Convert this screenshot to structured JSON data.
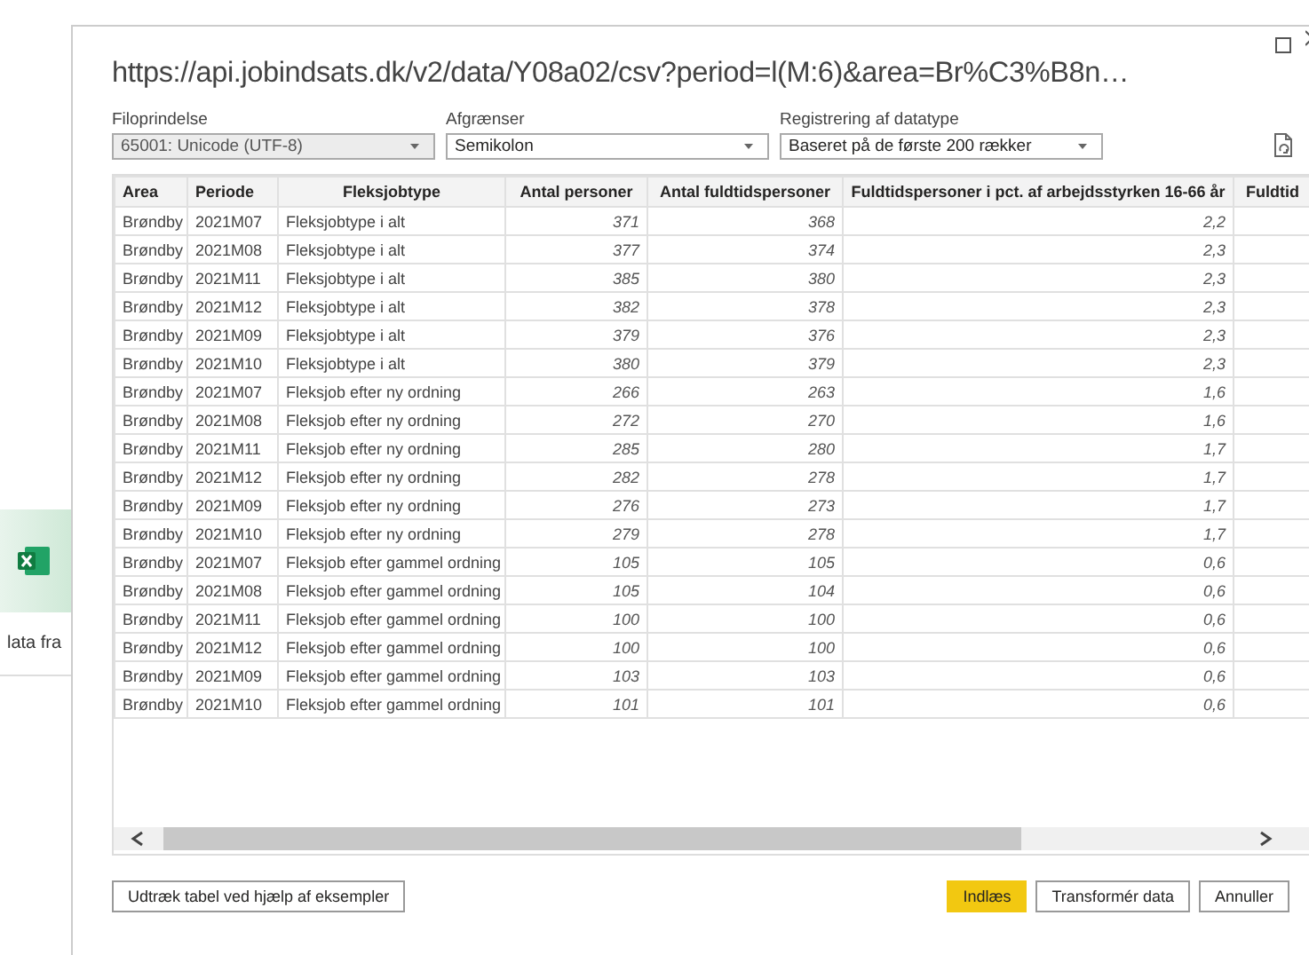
{
  "background_window": {
    "text": "lata fra"
  },
  "dialog": {
    "title": "https://api.jobindsats.dk/v2/data/Y08a02/csv?period=l(M:6)&area=Br%C3%B8n…"
  },
  "options": [
    {
      "label": "Filoprindelse",
      "value": "65001: Unicode (UTF-8)",
      "disabled": true
    },
    {
      "label": "Afgrænser",
      "value": "Semikolon",
      "disabled": false
    },
    {
      "label": "Registrering af datatype",
      "value": "Baseret på de første 200 rækker",
      "disabled": false
    }
  ],
  "table": {
    "columns": [
      {
        "label": "Area"
      },
      {
        "label": "Periode"
      },
      {
        "label": "Fleksjobtype"
      },
      {
        "label": "Antal personer"
      },
      {
        "label": "Antal fuldtidspersoner"
      },
      {
        "label": "Fuldtidspersoner i pct. af arbejdsstyrken 16-66 år"
      },
      {
        "label": "Fuldtid"
      }
    ],
    "rows": [
      [
        "Brøndby",
        "2021M07",
        "Fleksjobtype i alt",
        "371",
        "368",
        "2,2"
      ],
      [
        "Brøndby",
        "2021M08",
        "Fleksjobtype i alt",
        "377",
        "374",
        "2,3"
      ],
      [
        "Brøndby",
        "2021M11",
        "Fleksjobtype i alt",
        "385",
        "380",
        "2,3"
      ],
      [
        "Brøndby",
        "2021M12",
        "Fleksjobtype i alt",
        "382",
        "378",
        "2,3"
      ],
      [
        "Brøndby",
        "2021M09",
        "Fleksjobtype i alt",
        "379",
        "376",
        "2,3"
      ],
      [
        "Brøndby",
        "2021M10",
        "Fleksjobtype i alt",
        "380",
        "379",
        "2,3"
      ],
      [
        "Brøndby",
        "2021M07",
        "Fleksjob efter ny ordning",
        "266",
        "263",
        "1,6"
      ],
      [
        "Brøndby",
        "2021M08",
        "Fleksjob efter ny ordning",
        "272",
        "270",
        "1,6"
      ],
      [
        "Brøndby",
        "2021M11",
        "Fleksjob efter ny ordning",
        "285",
        "280",
        "1,7"
      ],
      [
        "Brøndby",
        "2021M12",
        "Fleksjob efter ny ordning",
        "282",
        "278",
        "1,7"
      ],
      [
        "Brøndby",
        "2021M09",
        "Fleksjob efter ny ordning",
        "276",
        "273",
        "1,7"
      ],
      [
        "Brøndby",
        "2021M10",
        "Fleksjob efter ny ordning",
        "279",
        "278",
        "1,7"
      ],
      [
        "Brøndby",
        "2021M07",
        "Fleksjob efter gammel ordning",
        "105",
        "105",
        "0,6"
      ],
      [
        "Brøndby",
        "2021M08",
        "Fleksjob efter gammel ordning",
        "105",
        "104",
        "0,6"
      ],
      [
        "Brøndby",
        "2021M11",
        "Fleksjob efter gammel ordning",
        "100",
        "100",
        "0,6"
      ],
      [
        "Brøndby",
        "2021M12",
        "Fleksjob efter gammel ordning",
        "100",
        "100",
        "0,6"
      ],
      [
        "Brøndby",
        "2021M09",
        "Fleksjob efter gammel ordning",
        "103",
        "103",
        "0,6"
      ],
      [
        "Brøndby",
        "2021M10",
        "Fleksjob efter gammel ordning",
        "101",
        "101",
        "0,6"
      ]
    ]
  },
  "buttons": [
    {
      "label": "Udtræk tabel ved hjælp af eksempler",
      "kind": "secondary"
    },
    {
      "label": "Indlæs",
      "kind": "primary"
    },
    {
      "label": "Transformér data",
      "kind": "secondary"
    },
    {
      "label": "Annuller",
      "kind": "secondary"
    }
  ]
}
